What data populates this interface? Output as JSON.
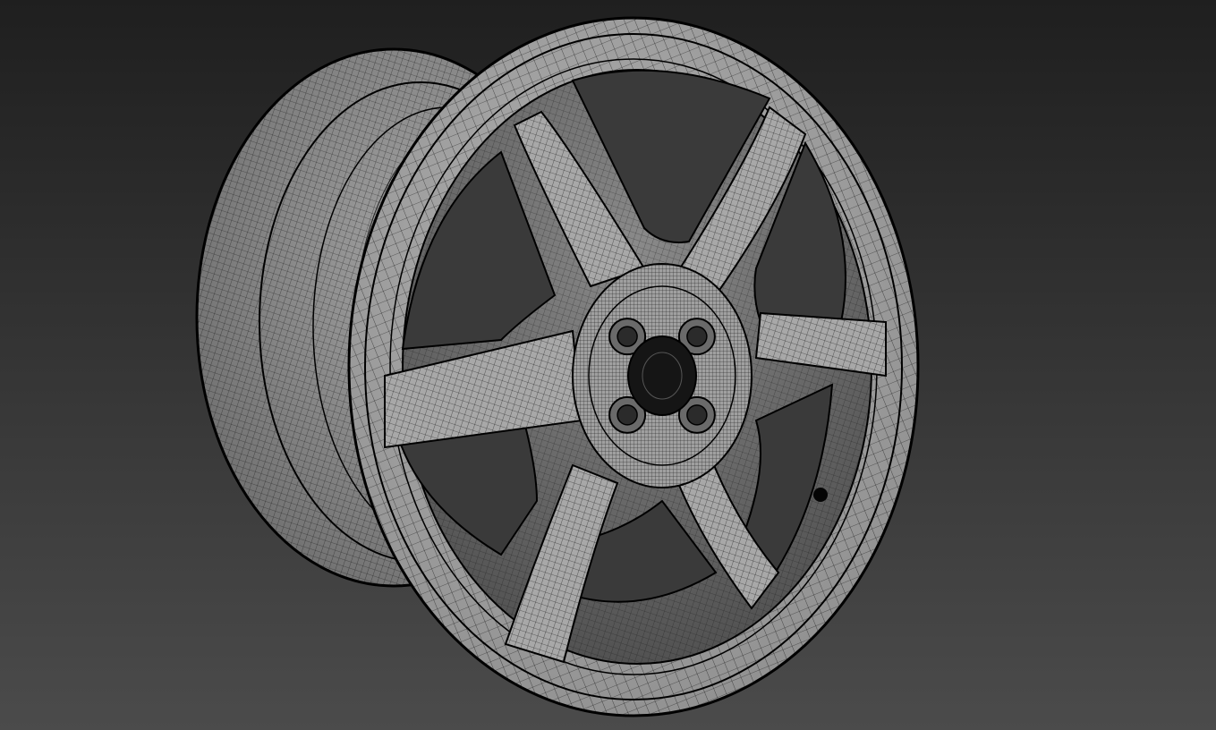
{
  "viewport": {
    "active_border_color": "#c9a64a",
    "background_top": "#1f1f1f",
    "background_bottom": "#4b4b4b",
    "display_mode": "wireframe-on-shaded"
  },
  "model": {
    "object": "wheel-rim",
    "spoke_count": 6,
    "lug_nut_count": 4,
    "surface_color": "#a2a2a2",
    "wire_color": "#111111"
  }
}
